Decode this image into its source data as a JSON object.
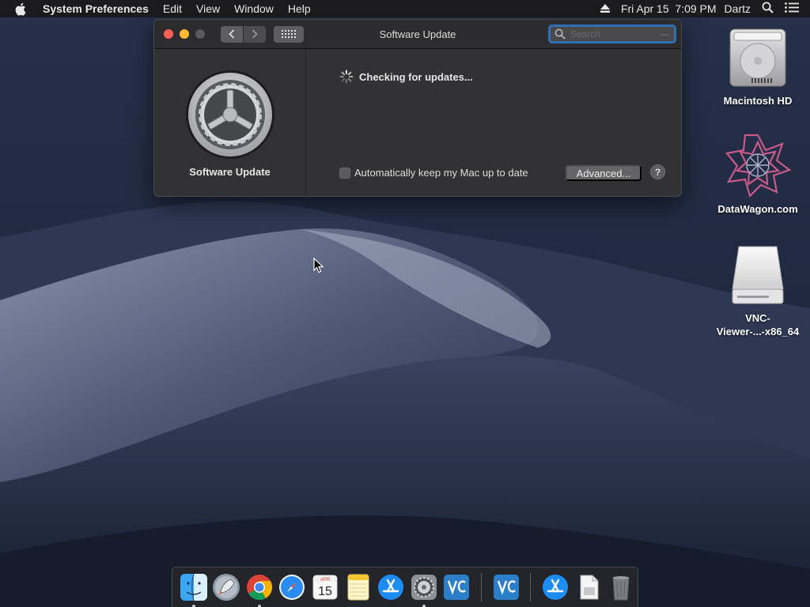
{
  "menubar": {
    "app_name": "System Preferences",
    "menus": [
      "Edit",
      "View",
      "Window",
      "Help"
    ],
    "clock": "Fri Apr 15  7:09 PM",
    "user": "Dartz"
  },
  "window": {
    "title": "Software Update",
    "search_placeholder": "Search",
    "sidebar_label": "Software Update",
    "status_text": "Checking for updates...",
    "auto_update_label": "Automatically keep my Mac up to date",
    "auto_update_checked": false,
    "advanced_label": "Advanced...",
    "help_label": "?"
  },
  "desktop": {
    "icons": [
      {
        "label": "Macintosh HD"
      },
      {
        "label": "DataWagon.com"
      },
      {
        "label_line1": "VNC-",
        "label_line2": "Viewer-...-x86_64"
      }
    ]
  },
  "dock": {
    "items": [
      "finder",
      "launchpad",
      "chrome",
      "safari",
      "calendar",
      "notes",
      "app-store",
      "system-preferences",
      "vnc-viewer",
      "vnc-viewer-2",
      "app-store-downloads",
      "disk-image",
      "trash"
    ],
    "calendar_month": "APR",
    "calendar_day": "15"
  },
  "colors": {
    "close": "#fe5f57",
    "minimize": "#febc2e",
    "search_focus": "#2f6fb4"
  }
}
